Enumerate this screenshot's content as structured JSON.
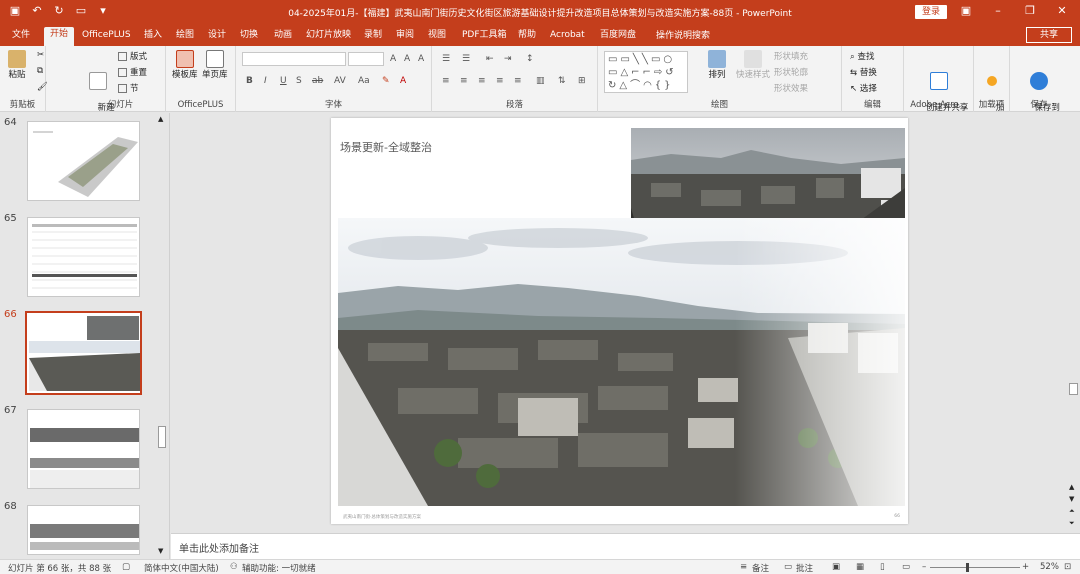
{
  "window": {
    "title": "04-2025年01月-【福建】武夷山南门街历史文化街区旅游基础设计提升改造项目总体策划与改造实施方案-88页  -  PowerPoint",
    "login_label": "登录",
    "share_label": "共享",
    "brand_color": "#c43e1c"
  },
  "tabs": [
    "文件",
    "开始",
    "OfficePLUS",
    "插入",
    "绘图",
    "设计",
    "切换",
    "动画",
    "幻灯片放映",
    "录制",
    "审阅",
    "视图",
    "PDF工具箱",
    "帮助",
    "Acrobat",
    "百度网盘"
  ],
  "active_tab": "开始",
  "tell_me": "操作说明搜索",
  "ribbon": {
    "clipboard": {
      "label": "剪贴板",
      "paste": "粘贴"
    },
    "slides": {
      "label": "幻灯片",
      "new_slide": "新建\n幻灯片",
      "layout": "版式",
      "reset": "重置",
      "section": "节"
    },
    "officeplus": {
      "label": "OfficePLUS",
      "template": "模板库",
      "single": "单页库"
    },
    "font": {
      "label": "字体"
    },
    "paragraph": {
      "label": "段落"
    },
    "drawing": {
      "label": "绘图",
      "arrange": "排列",
      "quick_styles": "快速样式",
      "shape_fill": "形状填充",
      "shape_outline": "形状轮廓",
      "shape_effect": "形状效果"
    },
    "editing": {
      "label": "编辑",
      "find": "查找",
      "replace": "替换",
      "select": "选择"
    },
    "adobe": {
      "label": "Adobe Acro...",
      "create": "创建并共享\nAdobe PDF"
    },
    "addins": {
      "label": "加载项",
      "addin": "加\n载项"
    },
    "save": {
      "label": "保存",
      "save_baidu": "保存到\n百度网盘"
    }
  },
  "thumbnails": [
    {
      "num": "64",
      "active": false
    },
    {
      "num": "65",
      "active": false
    },
    {
      "num": "66",
      "active": true
    },
    {
      "num": "67",
      "active": false
    },
    {
      "num": "68",
      "active": false
    }
  ],
  "slide": {
    "title": "场景更新-全域整治",
    "footer": "武夷山南门街·总体策划与改造实施方案",
    "page_num": "66"
  },
  "notes_placeholder": "单击此处添加备注",
  "status": {
    "slide_info": "幻灯片 第 66 张，共 88 张",
    "language": "简体中文(中国大陆)",
    "accessibility": "辅助功能: 一切就绪",
    "notes_btn": "备注",
    "comments_btn": "批注",
    "zoom": "52%"
  }
}
